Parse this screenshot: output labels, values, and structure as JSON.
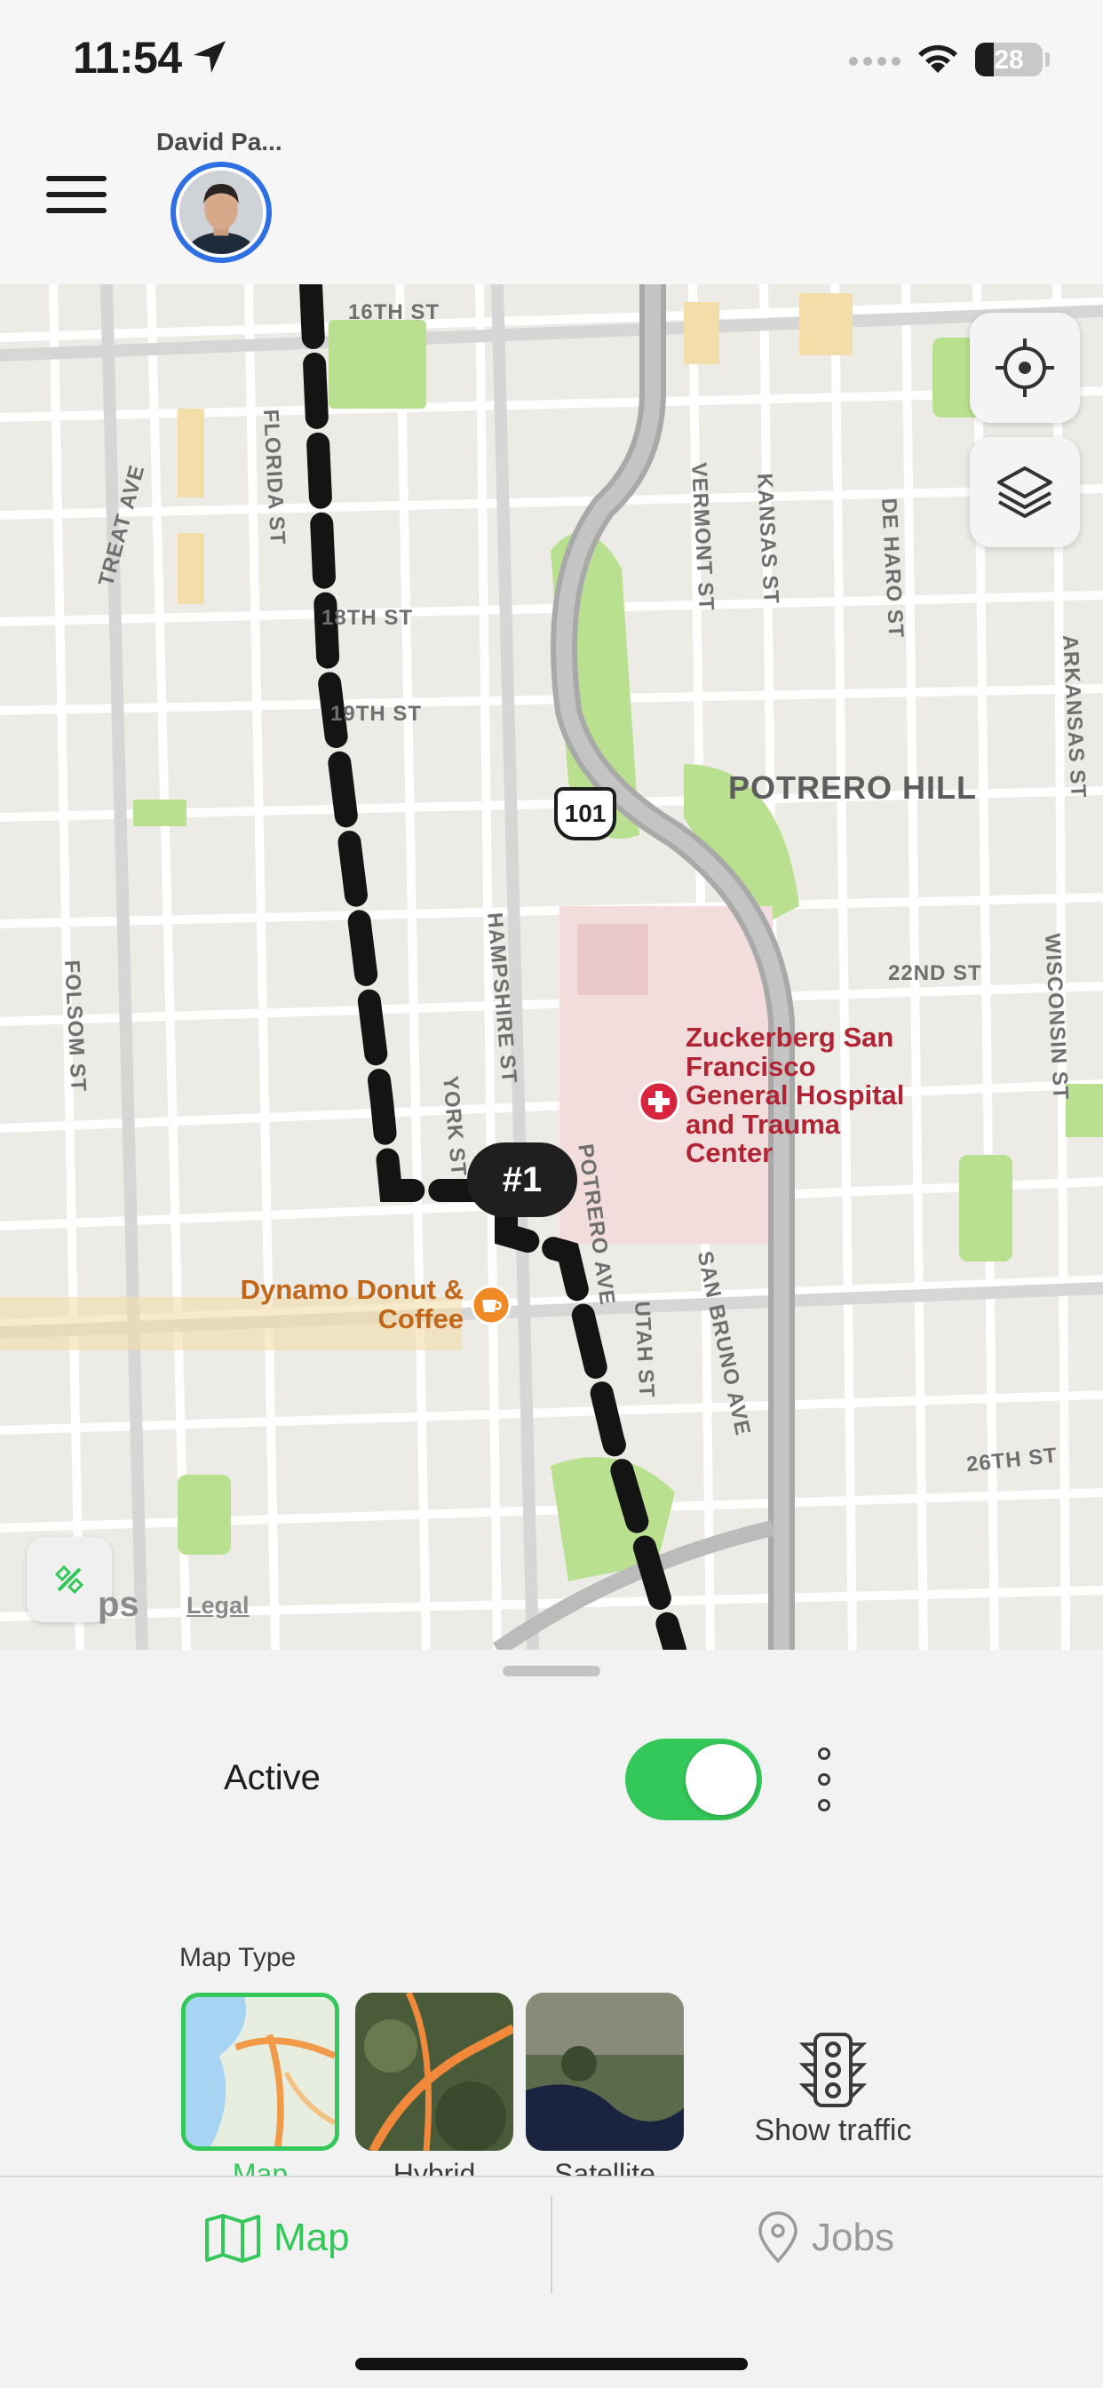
{
  "status_bar": {
    "time": "11:54",
    "battery_percent": "28",
    "icons": [
      "location-arrow-icon",
      "signal-dots-icon",
      "wifi-icon",
      "battery-icon"
    ]
  },
  "header": {
    "menu_icon": "hamburger-icon",
    "user_name": "David Pa..."
  },
  "map": {
    "streets": [
      "16TH ST",
      "FLORIDA ST",
      "TREAT AVE",
      "18TH ST",
      "19TH ST",
      "VERMONT ST",
      "KANSAS ST",
      "DE HARO ST",
      "ARKANSAS ST",
      "22ND ST",
      "WISCONSIN ST",
      "FOLSOM ST",
      "HAMPSHIRE ST",
      "YORK ST",
      "POTRERO AVE",
      "UTAH ST",
      "SAN BRUNO AVE",
      "26TH ST"
    ],
    "neighborhood": "POTRERO HILL",
    "highway_shield": "101",
    "hospital_name": "Zuckerberg San Francisco General Hospital and Trauma Center",
    "cafe_name": "Dynamo Donut & Coffee",
    "stop_label": "#1",
    "brand_suffix": "ps",
    "legal_link": "Legal",
    "controls": [
      "locate-me",
      "map-layers",
      "compass"
    ]
  },
  "sheet": {
    "active_label": "Active",
    "active_on": true,
    "map_type_label": "Map Type",
    "map_types": [
      {
        "name": "Map",
        "selected": true
      },
      {
        "name": "Hybrid",
        "selected": false
      },
      {
        "name": "Satellite",
        "selected": false
      }
    ],
    "traffic_label": "Show traffic"
  },
  "tabs": [
    {
      "label": "Map",
      "icon": "map-icon",
      "active": true
    },
    {
      "label": "Jobs",
      "icon": "location-pin-icon",
      "active": false
    }
  ],
  "colors": {
    "accent_green": "#34c759",
    "avatar_ring": "#2f6fe4",
    "hospital_red": "#b02434",
    "cafe_orange": "#c2661a"
  }
}
